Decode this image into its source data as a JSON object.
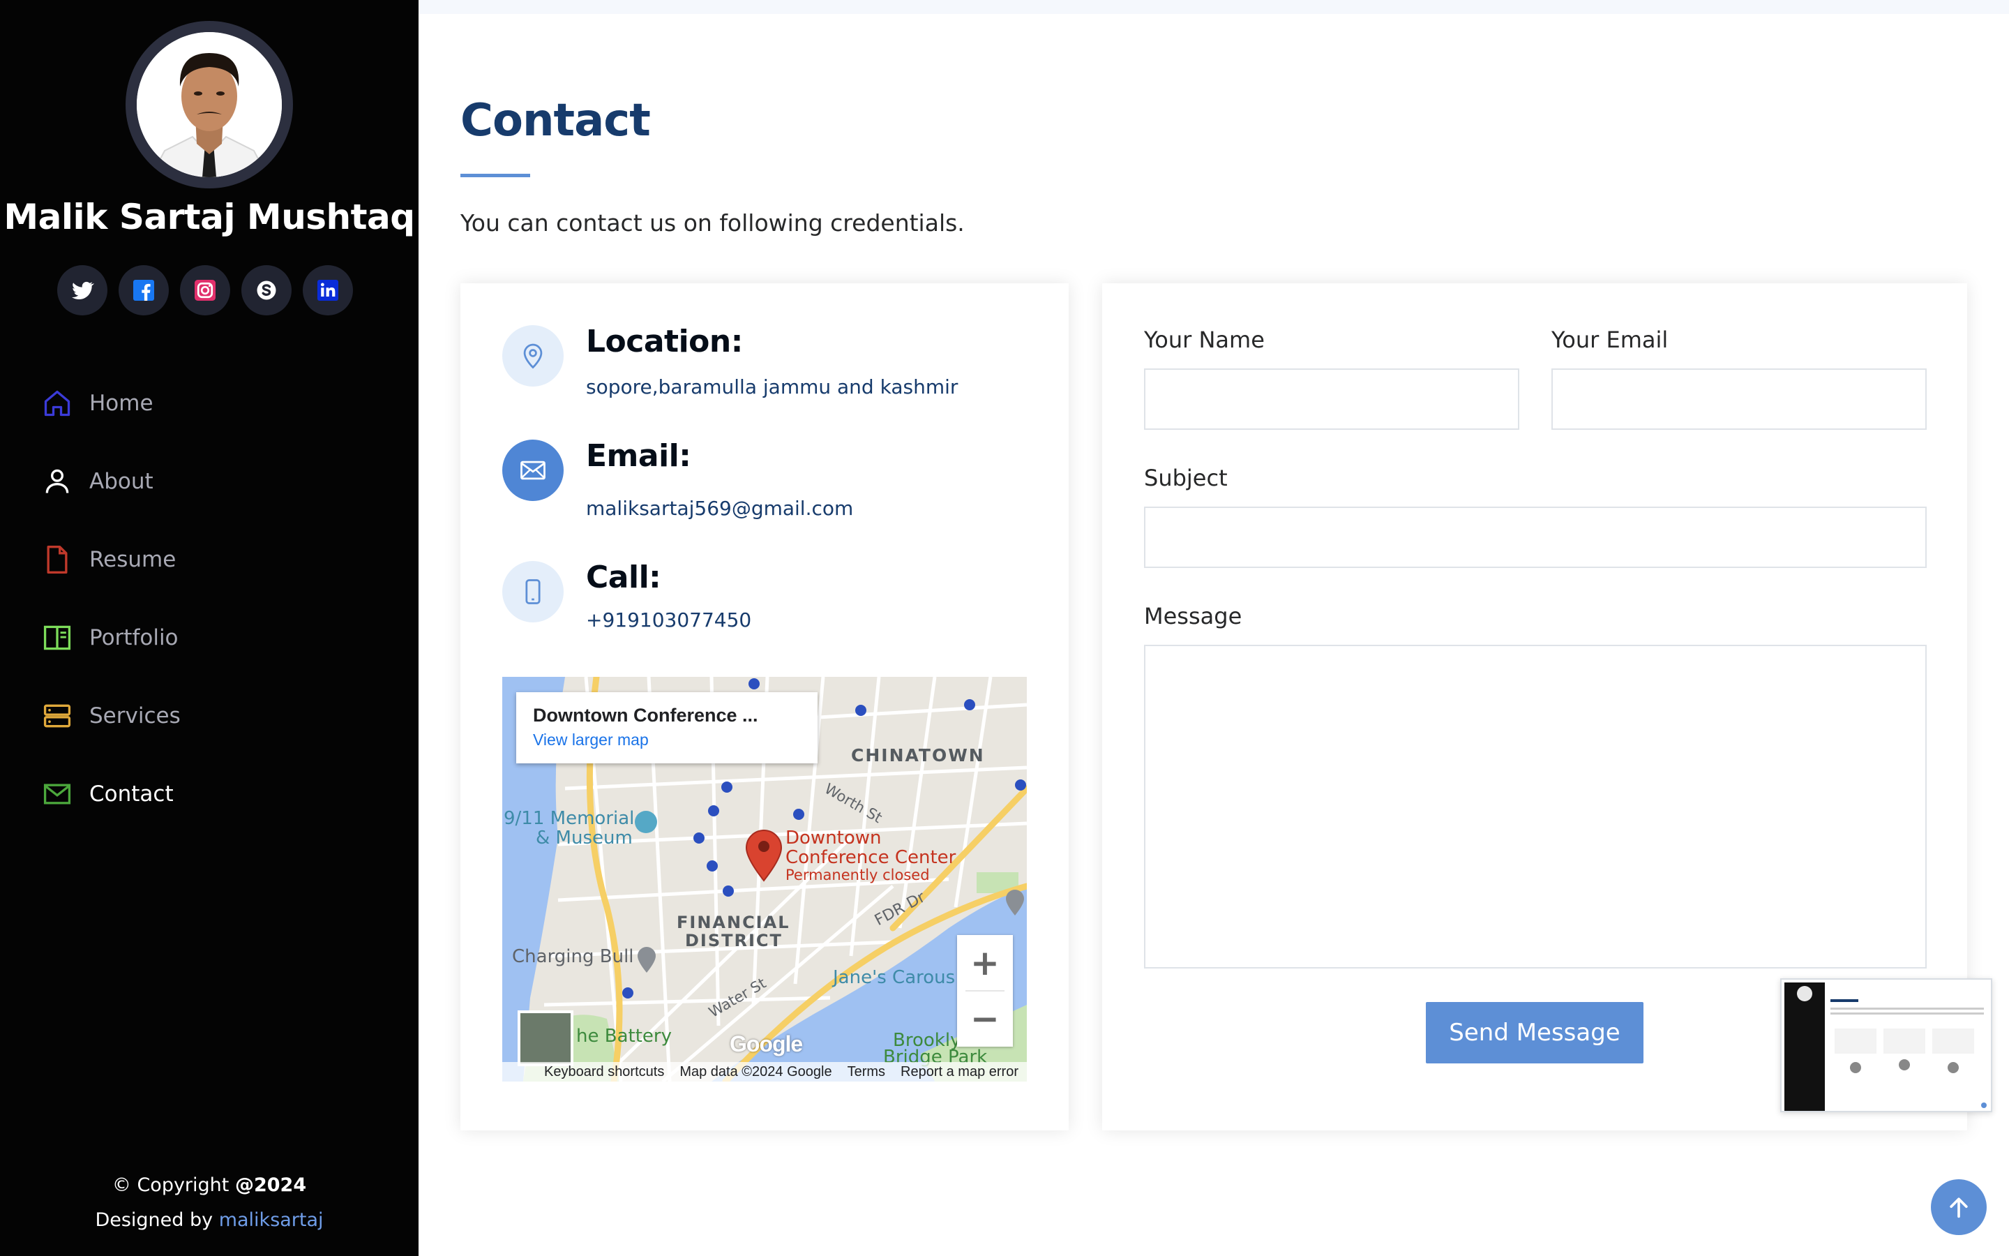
{
  "profile": {
    "name": "Malik Sartaj Mushtaq",
    "social": [
      {
        "icon": "twitter-icon",
        "color": "#ffffff"
      },
      {
        "icon": "facebook-icon",
        "color": "#1877f2"
      },
      {
        "icon": "instagram-icon",
        "color": "#e1306c"
      },
      {
        "icon": "skype-icon",
        "color": "#ffffff"
      },
      {
        "icon": "linkedin-icon",
        "color": "#0a66c2"
      }
    ]
  },
  "nav": {
    "items": [
      {
        "label": "Home",
        "icon": "home-icon",
        "icon_color": "#3b3bd8"
      },
      {
        "label": "About",
        "icon": "person-icon",
        "icon_color": "#ffffff"
      },
      {
        "label": "Resume",
        "icon": "file-icon",
        "icon_color": "#c0392b"
      },
      {
        "label": "Portfolio",
        "icon": "book-icon",
        "icon_color": "#7ddc5a"
      },
      {
        "label": "Services",
        "icon": "server-icon",
        "icon_color": "#e0a93b"
      },
      {
        "label": "Contact",
        "icon": "envelope-icon",
        "icon_color": "#4ca83c",
        "active": true
      }
    ]
  },
  "footer": {
    "copyright_prefix": "© Copyright",
    "copyright_year": "@2024",
    "designed_prefix": "Designed by",
    "designer": "maliksartaj"
  },
  "section": {
    "title": "Contact",
    "description": "You can contact us on following credentials."
  },
  "info": {
    "location_title": "Location:",
    "location_text": "sopore,baramulla jammu and kashmir",
    "email_title": "Email:",
    "email_text": "maliksartaj569@gmail.com",
    "call_title": "Call:",
    "call_text": "+919103077450"
  },
  "map": {
    "popup_title": "Downtown Conference ...",
    "popup_link": "View larger map",
    "labels": {
      "chinatown": "CHINATOWN",
      "worth_st": "Worth St",
      "memorial_1": "9/11 Memorial",
      "memorial_2": "& Museum",
      "place_1": "Downtown",
      "place_2": "Conference Center",
      "place_status": "Permanently closed",
      "financial_1": "FINANCIAL",
      "financial_2": "DISTRICT",
      "fdr": "FDR Dr",
      "charging_bull": "Charging Bull",
      "water_st": "Water St",
      "janes": "Jane's Carous",
      "battery": "he Battery",
      "brooklyn_1": "Brookly",
      "brooklyn_2": "Bridge Park"
    },
    "google": "Google",
    "footer": [
      "Keyboard shortcuts",
      "Map data ©2024 Google",
      "Terms",
      "Report a map error"
    ],
    "colors": {
      "land": "#e9e6df",
      "water": "#9fc1f2",
      "park": "#c7e3b4",
      "highway": "#f6cf65"
    }
  },
  "form": {
    "name_label": "Your Name",
    "email_label": "Your Email",
    "subject_label": "Subject",
    "message_label": "Message",
    "send_label": "Send Message"
  },
  "colors": {
    "sidebar": "#040404",
    "accent": "#5d8fd6",
    "heading": "#173b6c"
  }
}
